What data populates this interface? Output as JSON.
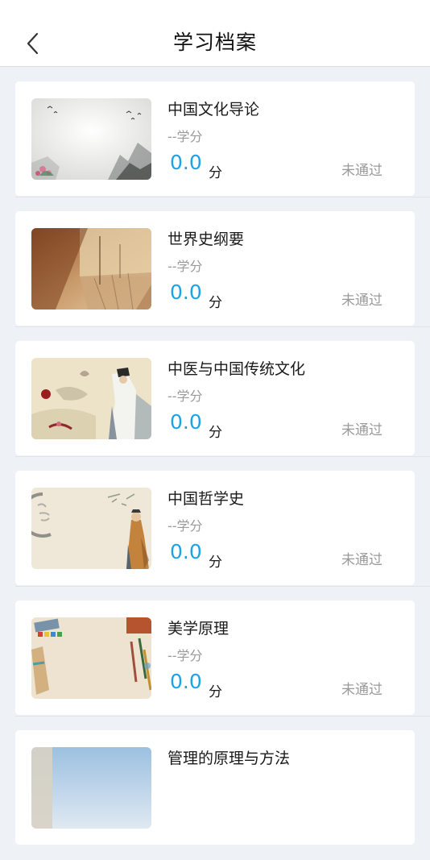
{
  "header": {
    "title": "学习档案",
    "back_icon": "chevron-left-icon"
  },
  "courses": [
    {
      "name": "中国文化导论",
      "credit": "--学分",
      "score": "0.0",
      "unit": "分",
      "status": "未通过",
      "thumb": "ink-landscape-image"
    },
    {
      "name": "世界史纲要",
      "credit": "--学分",
      "score": "0.0",
      "unit": "分",
      "status": "未通过",
      "thumb": "sepia-collage-image"
    },
    {
      "name": "中医与中国传统文化",
      "credit": "--学分",
      "score": "0.0",
      "unit": "分",
      "status": "未通过",
      "thumb": "scholar-painting-image"
    },
    {
      "name": "中国哲学史",
      "credit": "--学分",
      "score": "0.0",
      "unit": "分",
      "status": "未通过",
      "thumb": "confucius-painting-image"
    },
    {
      "name": "美学原理",
      "credit": "--学分",
      "score": "0.0",
      "unit": "分",
      "status": "未通过",
      "thumb": "art-supplies-image"
    },
    {
      "name": "管理的原理与方法",
      "credit": "",
      "score": "",
      "unit": "",
      "status": "",
      "thumb": "sky-image"
    }
  ],
  "colors": {
    "score": "#1aa3e8",
    "background": "#eef1f5",
    "muted": "#9a9a9a"
  }
}
